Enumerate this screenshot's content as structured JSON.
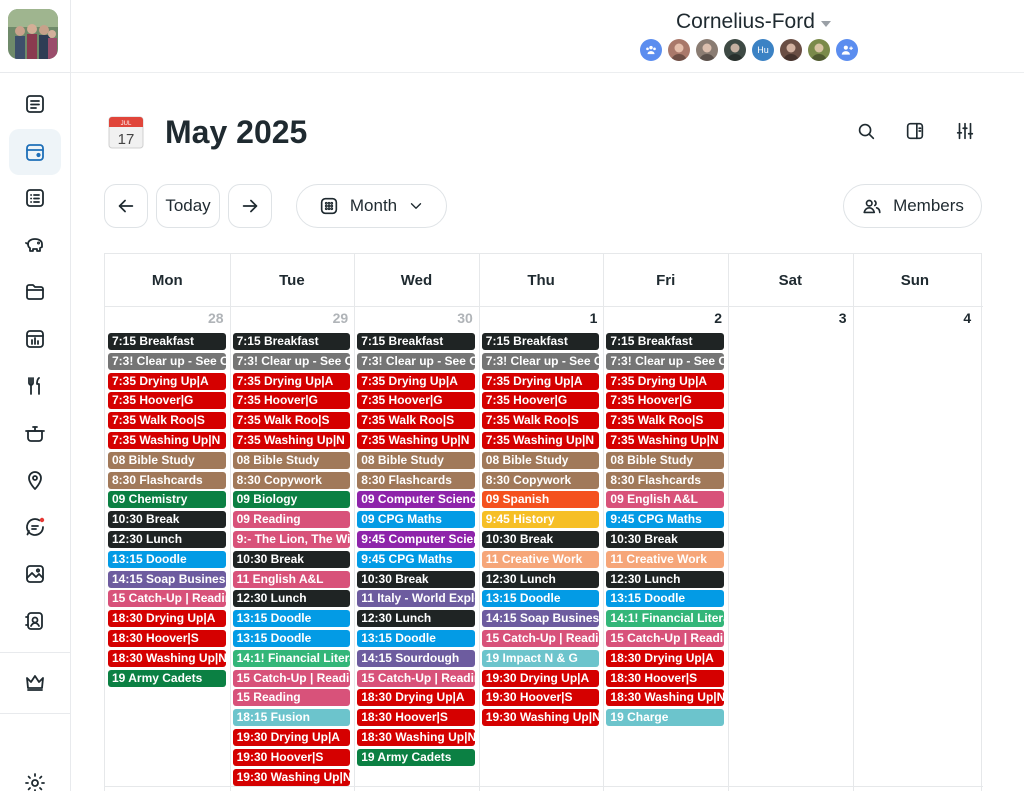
{
  "topbar": {
    "family_name": "Cornelius-Ford",
    "member_avatars": [
      {
        "kind": "group",
        "color": "#5b8def",
        "label": ""
      },
      {
        "kind": "photo",
        "color": "#a9786a",
        "label": ""
      },
      {
        "kind": "photo",
        "color": "#8a7c72",
        "label": ""
      },
      {
        "kind": "photo",
        "color": "#3e4a44",
        "label": ""
      },
      {
        "kind": "initials",
        "color": "#3b82c4",
        "label": "Hu"
      },
      {
        "kind": "photo",
        "color": "#6a4e44",
        "label": ""
      },
      {
        "kind": "photo",
        "color": "#7a8a4a",
        "label": ""
      },
      {
        "kind": "add",
        "color": "#5b8def",
        "label": ""
      }
    ]
  },
  "sidebar": {
    "items": [
      {
        "icon": "notes-icon",
        "active": false
      },
      {
        "icon": "calendar-icon",
        "active": true
      },
      {
        "icon": "list-icon",
        "active": false
      },
      {
        "icon": "piggy-bank-icon",
        "active": false
      },
      {
        "icon": "folder-icon",
        "active": false
      },
      {
        "icon": "chart-icon",
        "active": false
      },
      {
        "icon": "cutlery-icon",
        "active": false
      },
      {
        "icon": "pot-icon",
        "active": false
      },
      {
        "icon": "location-pin-icon",
        "active": false
      },
      {
        "icon": "chat-icon",
        "active": false
      },
      {
        "icon": "image-icon",
        "active": false
      },
      {
        "icon": "contacts-icon",
        "active": false
      },
      {
        "icon": "crown-icon",
        "active": false
      },
      {
        "icon": "gear-icon",
        "active": false
      }
    ]
  },
  "header": {
    "cal_icon_month": "JUL",
    "cal_icon_day": "17",
    "title": "May 2025"
  },
  "toolbar": {
    "today_label": "Today",
    "view_label": "Month",
    "members_label": "Members"
  },
  "calendar": {
    "days_of_week": [
      "Mon",
      "Tue",
      "Wed",
      "Thu",
      "Fri",
      "Sat",
      "Sun"
    ],
    "day_numbers": [
      {
        "n": "28",
        "muted": true
      },
      {
        "n": "29",
        "muted": true
      },
      {
        "n": "30",
        "muted": true
      },
      {
        "n": "1",
        "muted": false
      },
      {
        "n": "2",
        "muted": false
      },
      {
        "n": "3",
        "muted": false
      },
      {
        "n": "4",
        "muted": false
      }
    ],
    "columns": [
      [
        {
          "t": "7:15 Breakfast",
          "c": "#1f2424"
        },
        {
          "t": "7:3! Clear up - See Cl",
          "c": "#757575"
        },
        {
          "t": "7:35 Drying Up|A",
          "c": "#d50000"
        },
        {
          "t": "7:35 Hoover|G",
          "c": "#d50000"
        },
        {
          "t": "7:35 Walk Roo|S",
          "c": "#d50000"
        },
        {
          "t": "7:35 Washing Up|N",
          "c": "#d50000"
        },
        {
          "t": "08 Bible Study",
          "c": "#a1795a"
        },
        {
          "t": "8:30 Flashcards",
          "c": "#a1795a"
        },
        {
          "t": "09 Chemistry",
          "c": "#0b8043"
        },
        {
          "t": "10:30 Break",
          "c": "#1f2424"
        },
        {
          "t": "12:30 Lunch",
          "c": "#1f2424"
        },
        {
          "t": "13:15 Doodle",
          "c": "#039be5"
        },
        {
          "t": "14:15 Soap Business",
          "c": "#6d5c9f"
        },
        {
          "t": "15 Catch-Up | Readin",
          "c": "#d8527a"
        },
        {
          "t": "18:30 Drying Up|A",
          "c": "#d50000"
        },
        {
          "t": "18:30 Hoover|S",
          "c": "#d50000"
        },
        {
          "t": "18:30 Washing Up|N",
          "c": "#d50000"
        },
        {
          "t": "19 Army Cadets",
          "c": "#0b8043"
        }
      ],
      [
        {
          "t": "7:15 Breakfast",
          "c": "#1f2424"
        },
        {
          "t": "7:3! Clear up - See Cl",
          "c": "#757575"
        },
        {
          "t": "7:35 Drying Up|A",
          "c": "#d50000"
        },
        {
          "t": "7:35 Hoover|G",
          "c": "#d50000"
        },
        {
          "t": "7:35 Walk Roo|S",
          "c": "#d50000"
        },
        {
          "t": "7:35 Washing Up|N",
          "c": "#d50000"
        },
        {
          "t": "08 Bible Study",
          "c": "#a1795a"
        },
        {
          "t": "8:30 Copywork",
          "c": "#a1795a"
        },
        {
          "t": "09 Biology",
          "c": "#0b8043"
        },
        {
          "t": "09 Reading",
          "c": "#d8527a"
        },
        {
          "t": "9:- The Lion, The Witc",
          "c": "#d8527a"
        },
        {
          "t": "10:30 Break",
          "c": "#1f2424"
        },
        {
          "t": "11 English A&L",
          "c": "#d8527a"
        },
        {
          "t": "12:30 Lunch",
          "c": "#1f2424"
        },
        {
          "t": "13:15 Doodle",
          "c": "#039be5"
        },
        {
          "t": "13:15 Doodle",
          "c": "#039be5"
        },
        {
          "t": "14:1! Financial Litera",
          "c": "#33b679"
        },
        {
          "t": "15 Catch-Up | Readin",
          "c": "#d8527a"
        },
        {
          "t": "15 Reading",
          "c": "#d8527a"
        },
        {
          "t": "18:15 Fusion",
          "c": "#6cc4cc"
        },
        {
          "t": "19:30 Drying Up|A",
          "c": "#d50000"
        },
        {
          "t": "19:30 Hoover|S",
          "c": "#d50000"
        },
        {
          "t": "19:30 Washing Up|N",
          "c": "#d50000"
        }
      ],
      [
        {
          "t": "7:15 Breakfast",
          "c": "#1f2424"
        },
        {
          "t": "7:3! Clear up - See Cl",
          "c": "#757575"
        },
        {
          "t": "7:35 Drying Up|A",
          "c": "#d50000"
        },
        {
          "t": "7:35 Hoover|G",
          "c": "#d50000"
        },
        {
          "t": "7:35 Walk Roo|S",
          "c": "#d50000"
        },
        {
          "t": "7:35 Washing Up|N",
          "c": "#d50000"
        },
        {
          "t": "08 Bible Study",
          "c": "#a1795a"
        },
        {
          "t": "8:30 Flashcards",
          "c": "#a1795a"
        },
        {
          "t": "09 Computer Science",
          "c": "#8e24aa"
        },
        {
          "t": "09 CPG Maths",
          "c": "#039be5"
        },
        {
          "t": "9:45 Computer Scien",
          "c": "#8e24aa"
        },
        {
          "t": "9:45 CPG Maths",
          "c": "#039be5"
        },
        {
          "t": "10:30 Break",
          "c": "#1f2424"
        },
        {
          "t": "11 Italy - World Explo",
          "c": "#6d5c9f"
        },
        {
          "t": "12:30 Lunch",
          "c": "#1f2424"
        },
        {
          "t": "13:15 Doodle",
          "c": "#039be5"
        },
        {
          "t": "14:15 Sourdough",
          "c": "#6d5c9f"
        },
        {
          "t": "15 Catch-Up | Readin",
          "c": "#d8527a"
        },
        {
          "t": "18:30 Drying Up|A",
          "c": "#d50000"
        },
        {
          "t": "18:30 Hoover|S",
          "c": "#d50000"
        },
        {
          "t": "18:30 Washing Up|N",
          "c": "#d50000"
        },
        {
          "t": "19 Army Cadets",
          "c": "#0b8043"
        }
      ],
      [
        {
          "t": "7:15 Breakfast",
          "c": "#1f2424"
        },
        {
          "t": "7:3! Clear up - See Cl",
          "c": "#757575"
        },
        {
          "t": "7:35 Drying Up|A",
          "c": "#d50000"
        },
        {
          "t": "7:35 Hoover|G",
          "c": "#d50000"
        },
        {
          "t": "7:35 Walk Roo|S",
          "c": "#d50000"
        },
        {
          "t": "7:35 Washing Up|N",
          "c": "#d50000"
        },
        {
          "t": "08 Bible Study",
          "c": "#a1795a"
        },
        {
          "t": "8:30 Copywork",
          "c": "#a1795a"
        },
        {
          "t": "09 Spanish",
          "c": "#f4511e"
        },
        {
          "t": "9:45 History",
          "c": "#f6bf26"
        },
        {
          "t": "10:30 Break",
          "c": "#1f2424"
        },
        {
          "t": "11 Creative Work",
          "c": "#f6a679"
        },
        {
          "t": "12:30 Lunch",
          "c": "#1f2424"
        },
        {
          "t": "13:15 Doodle",
          "c": "#039be5"
        },
        {
          "t": "14:15 Soap Business",
          "c": "#6d5c9f"
        },
        {
          "t": "15 Catch-Up | Readin",
          "c": "#d8527a"
        },
        {
          "t": "19 Impact N & G",
          "c": "#6cc4cc"
        },
        {
          "t": "19:30 Drying Up|A",
          "c": "#d50000"
        },
        {
          "t": "19:30 Hoover|S",
          "c": "#d50000"
        },
        {
          "t": "19:30 Washing Up|N",
          "c": "#d50000"
        }
      ],
      [
        {
          "t": "7:15 Breakfast",
          "c": "#1f2424"
        },
        {
          "t": "7:3! Clear up - See Cl",
          "c": "#757575"
        },
        {
          "t": "7:35 Drying Up|A",
          "c": "#d50000"
        },
        {
          "t": "7:35 Hoover|G",
          "c": "#d50000"
        },
        {
          "t": "7:35 Walk Roo|S",
          "c": "#d50000"
        },
        {
          "t": "7:35 Washing Up|N",
          "c": "#d50000"
        },
        {
          "t": "08 Bible Study",
          "c": "#a1795a"
        },
        {
          "t": "8:30 Flashcards",
          "c": "#a1795a"
        },
        {
          "t": "09 English A&L",
          "c": "#d8527a"
        },
        {
          "t": "9:45 CPG Maths",
          "c": "#039be5"
        },
        {
          "t": "10:30 Break",
          "c": "#1f2424"
        },
        {
          "t": "11 Creative Work",
          "c": "#f6a679"
        },
        {
          "t": "12:30 Lunch",
          "c": "#1f2424"
        },
        {
          "t": "13:15 Doodle",
          "c": "#039be5"
        },
        {
          "t": "14:1! Financial Litera",
          "c": "#33b679"
        },
        {
          "t": "15 Catch-Up | Readin",
          "c": "#d8527a"
        },
        {
          "t": "18:30 Drying Up|A",
          "c": "#d50000"
        },
        {
          "t": "18:30 Hoover|S",
          "c": "#d50000"
        },
        {
          "t": "18:30 Washing Up|N",
          "c": "#d50000"
        },
        {
          "t": "19 Charge",
          "c": "#6cc4cc"
        }
      ],
      [],
      []
    ]
  }
}
